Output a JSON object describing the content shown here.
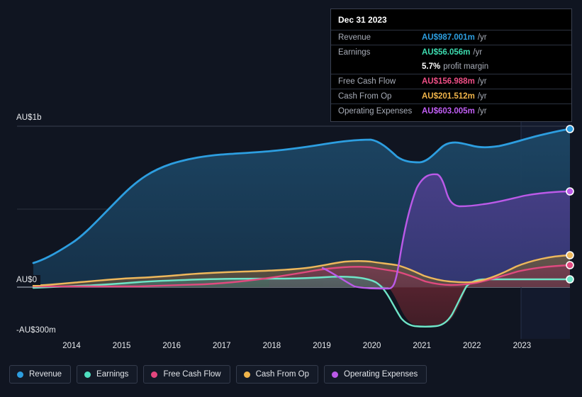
{
  "chart_data": {
    "type": "area",
    "title": "",
    "xlabel": "",
    "ylabel": "",
    "currency": "AU$",
    "ylim": [
      -300,
      1000
    ],
    "yticks": [
      {
        "value": 1000,
        "label": "AU$1b"
      },
      {
        "value": 0,
        "label": "AU$0"
      },
      {
        "value": -300,
        "label": "-AU$300m"
      }
    ],
    "grid": true,
    "legend_position": "bottom",
    "categories": [
      2013.6,
      2014,
      2015,
      2016,
      2017,
      2018,
      2019,
      2019.5,
      2020,
      2020.5,
      2021,
      2021.5,
      2022,
      2022.5,
      2023,
      2023.9
    ],
    "tick_years": [
      "2014",
      "2015",
      "2016",
      "2017",
      "2018",
      "2019",
      "2020",
      "2021",
      "2022",
      "2023"
    ],
    "series": [
      {
        "name": "Revenue",
        "color": "#2d9ee0",
        "values": [
          150,
          196,
          350,
          520,
          610,
          640,
          700,
          760,
          820,
          745,
          735,
          820,
          800,
          795,
          880,
          987.001
        ],
        "end_value": "AU$987.001m"
      },
      {
        "name": "Earnings",
        "color": "#6fe5c8",
        "values": [
          -8,
          -6,
          0,
          6,
          22,
          24,
          26,
          24,
          18,
          -255,
          -262,
          -245,
          8,
          14,
          22,
          56.056
        ],
        "end_value": "AU$56.056m"
      },
      {
        "name": "Free Cash Flow",
        "color": "#e04a7f",
        "values": [
          0,
          -4,
          0,
          4,
          18,
          22,
          26,
          55,
          70,
          82,
          60,
          20,
          8,
          38,
          88,
          156.988
        ],
        "end_value": "AU$156.988m"
      },
      {
        "name": "Cash From Op",
        "color": "#eeb85c",
        "values": [
          5,
          6,
          18,
          24,
          48,
          52,
          58,
          78,
          92,
          100,
          84,
          36,
          28,
          70,
          130,
          201.512
        ],
        "end_value": "AU$201.512m"
      },
      {
        "name": "Operating Expenses",
        "color": "#bb5ae8",
        "values": [
          null,
          null,
          null,
          null,
          null,
          null,
          62,
          20,
          -6,
          -6,
          520,
          640,
          465,
          480,
          530,
          603.005
        ],
        "end_value": "AU$603.005m",
        "starts_at": 2019
      }
    ]
  },
  "tooltip": {
    "date": "Dec 31 2023",
    "rows": [
      {
        "label": "Revenue",
        "value": "AU$987.001m",
        "unit": "/yr",
        "color": "#2d9ee0"
      },
      {
        "label": "Earnings",
        "value": "AU$56.056m",
        "unit": "/yr",
        "color": "#3ddcb0"
      },
      {
        "label": "",
        "value": "5.7%",
        "unit": "profit margin",
        "color": "#ffffff",
        "sub": true
      },
      {
        "label": "Free Cash Flow",
        "value": "AU$156.988m",
        "unit": "/yr",
        "color": "#ef4e86"
      },
      {
        "label": "Cash From Op",
        "value": "AU$201.512m",
        "unit": "/yr",
        "color": "#f0b44a"
      },
      {
        "label": "Operating Expenses",
        "value": "AU$603.005m",
        "unit": "/yr",
        "color": "#c15ef5"
      }
    ]
  },
  "legend": {
    "items": [
      {
        "label": "Revenue",
        "color": "#2d9ee0"
      },
      {
        "label": "Earnings",
        "color": "#4fdfc0"
      },
      {
        "label": "Free Cash Flow",
        "color": "#e4467e"
      },
      {
        "label": "Cash From Op",
        "color": "#f0b44a"
      },
      {
        "label": "Operating Expenses",
        "color": "#bb5ae8"
      }
    ]
  },
  "yaxis": {
    "top_label": "AU$1b",
    "zero_label": "AU$0",
    "bottom_label": "-AU$300m"
  },
  "xaxis": {
    "ticks": [
      "2014",
      "2015",
      "2016",
      "2017",
      "2018",
      "2019",
      "2020",
      "2021",
      "2022",
      "2023"
    ]
  }
}
